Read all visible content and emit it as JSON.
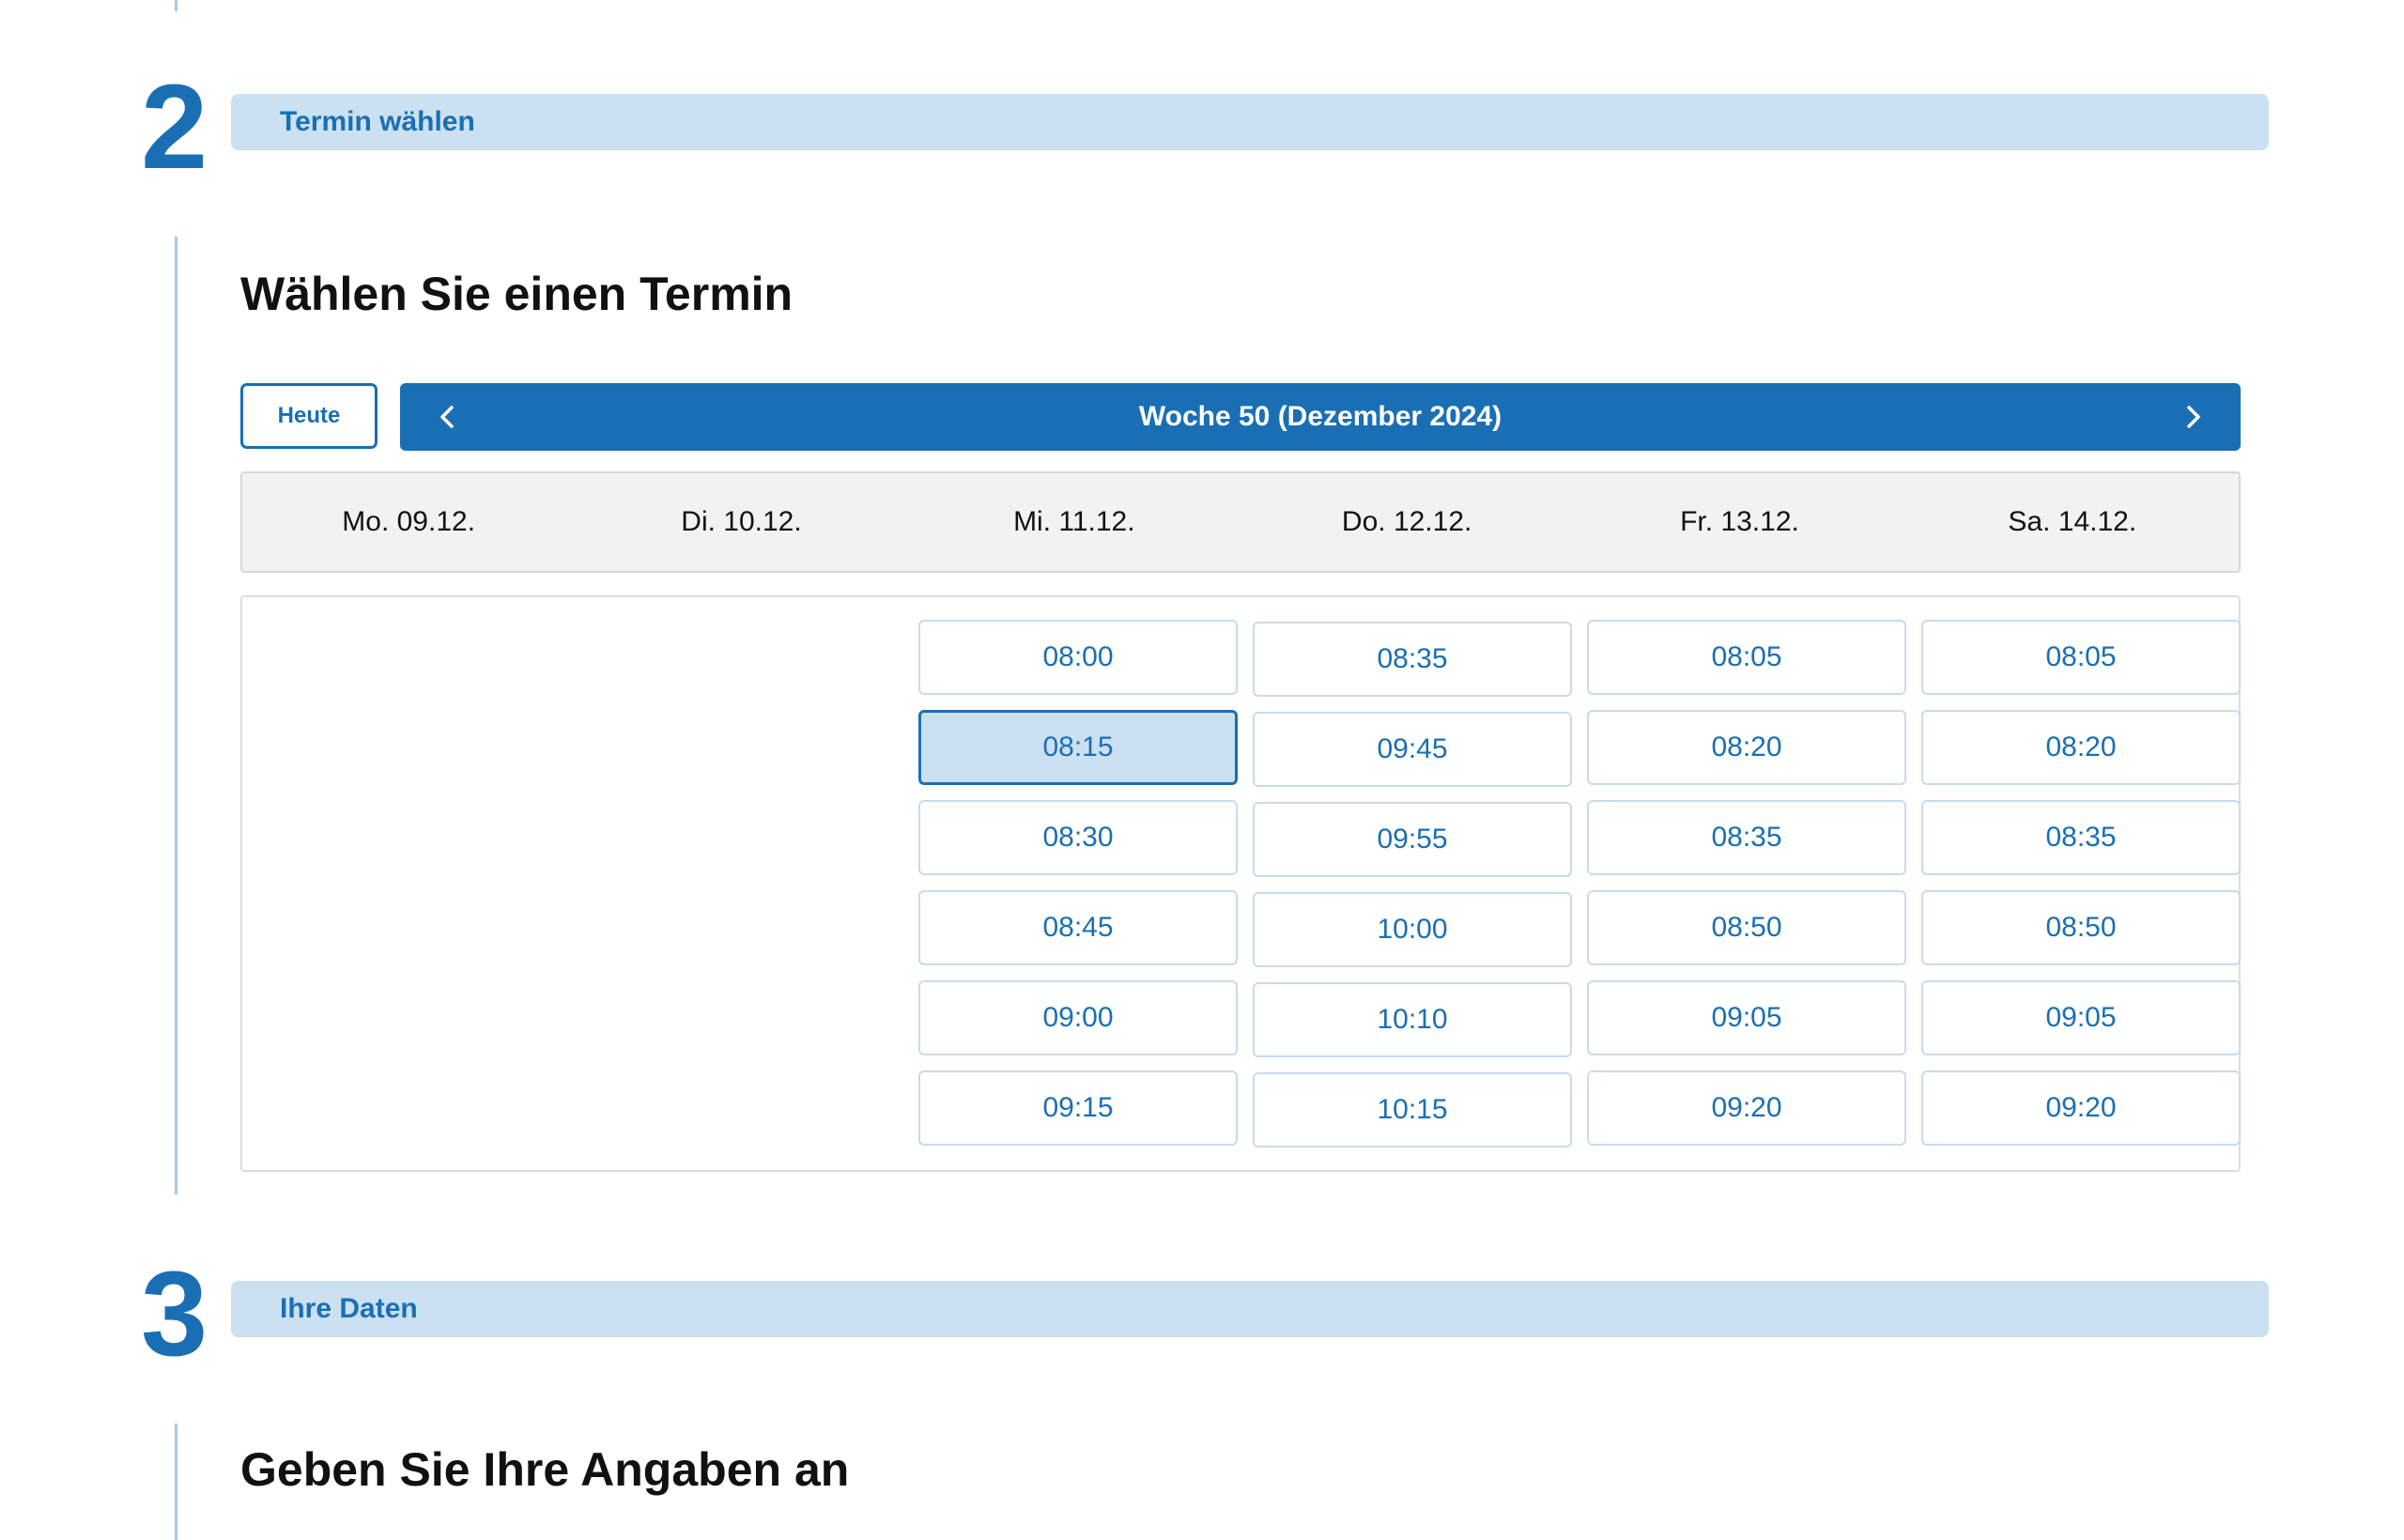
{
  "step2": {
    "number": "2",
    "title": "Termin wählen",
    "heading": "Wählen Sie einen Termin"
  },
  "calendar": {
    "today_label": "Heute",
    "week_label": "Woche 50 (Dezember 2024)",
    "prev_icon": "chevron-left-icon",
    "next_icon": "chevron-right-icon",
    "days": [
      "Mo. 09.12.",
      "Di. 10.12.",
      "Mi. 11.12.",
      "Do. 12.12.",
      "Fr. 13.12.",
      "Sa. 14.12."
    ],
    "slots": {
      "mi": [
        "08:00",
        "08:15",
        "08:30",
        "08:45",
        "09:00",
        "09:15"
      ],
      "do": [
        "08:35",
        "09:45",
        "09:55",
        "10:00",
        "10:10",
        "10:15"
      ],
      "fr": [
        "08:05",
        "08:20",
        "08:35",
        "08:50",
        "09:05",
        "09:20"
      ],
      "sa": [
        "08:05",
        "08:20",
        "08:35",
        "08:50",
        "09:05",
        "09:20"
      ]
    },
    "selected_slot": "Mi. 11.12. 08:15"
  },
  "step3": {
    "number": "3",
    "title": "Ihre Daten",
    "heading": "Geben Sie Ihre Angaben an"
  },
  "colors": {
    "primary": "#1a6fb4",
    "light": "#cbe0f1"
  }
}
